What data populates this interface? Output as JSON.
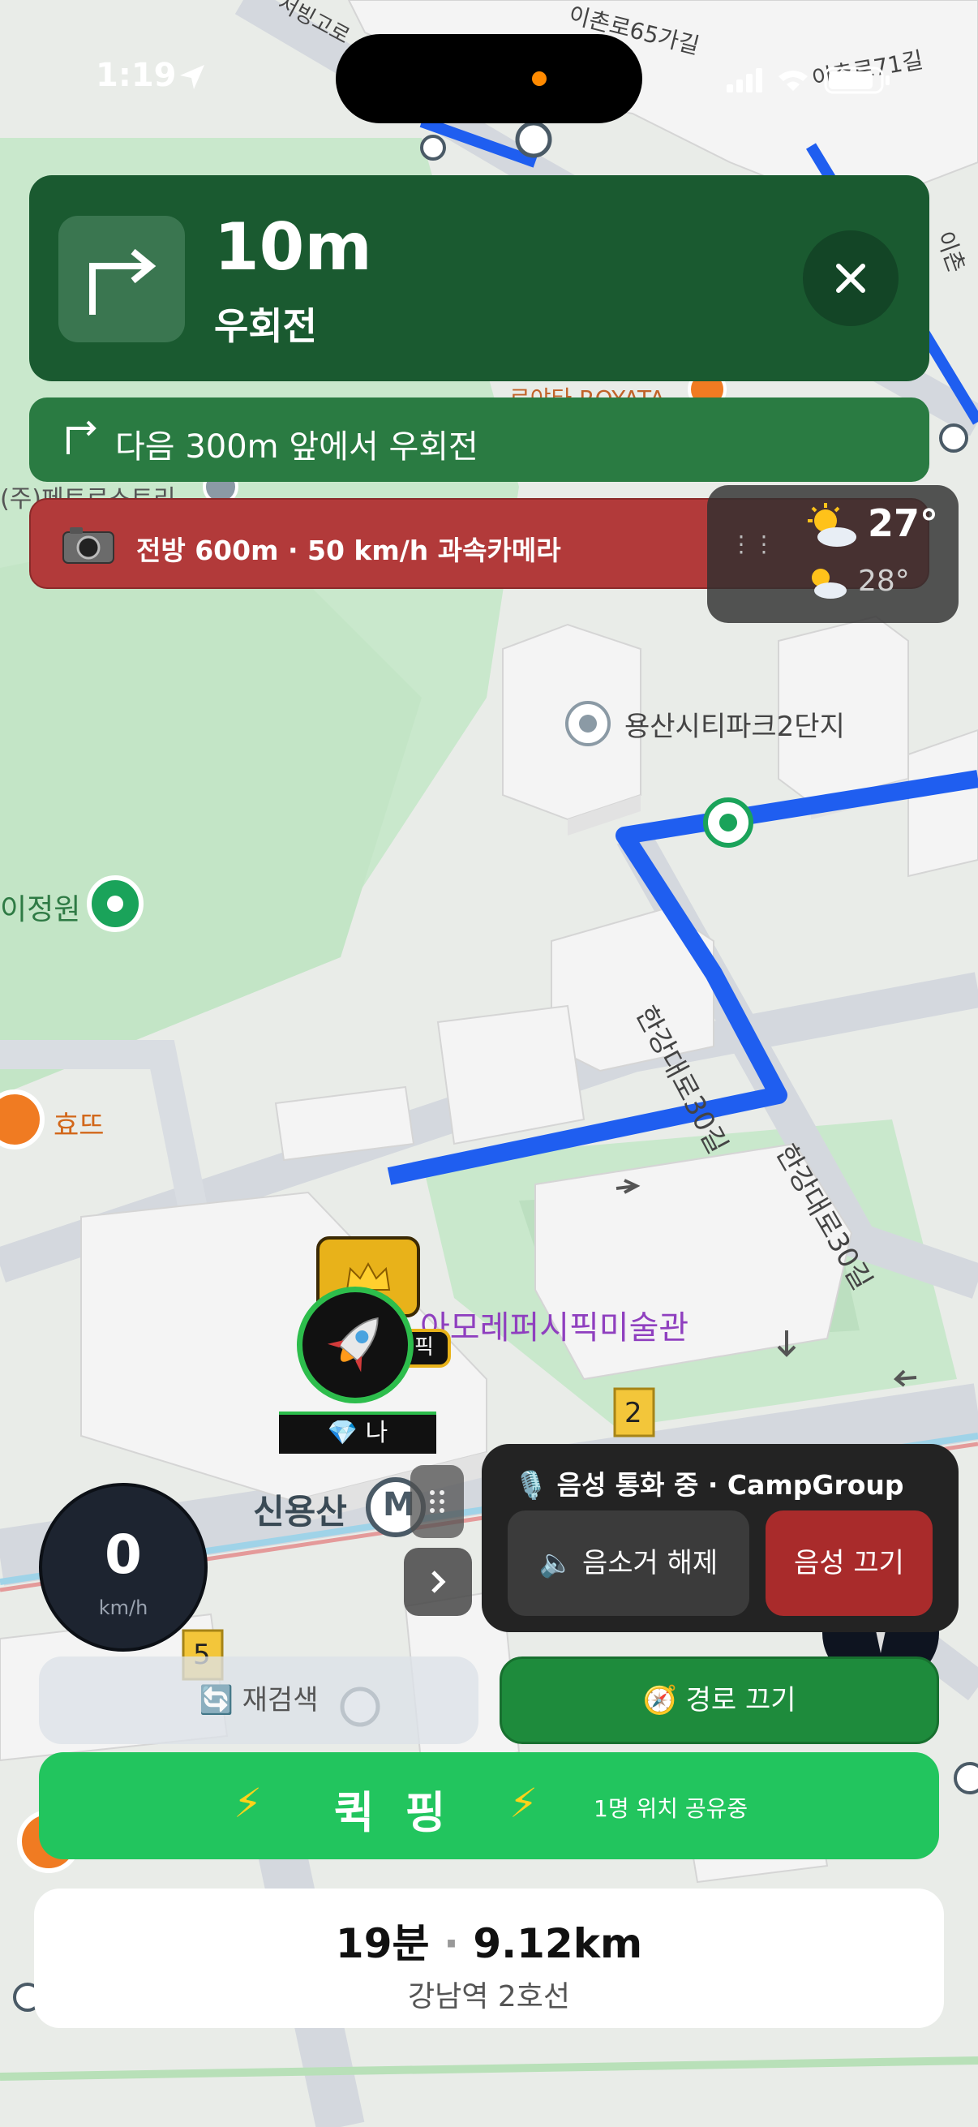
{
  "status": {
    "time": "1:19"
  },
  "turn": {
    "distance": "10m",
    "instruction": "우회전"
  },
  "next_turn": {
    "text": "다음 300m 앞에서 우회전"
  },
  "speed_camera": {
    "text": "전방 600m · 50 km/h 과속카메라"
  },
  "weather": {
    "current_temp": "27°",
    "next_temp": "28°"
  },
  "map_labels": {
    "poi_yongsan_citypark": "용산시티파크2단지",
    "poi_jeongwon": "이정원",
    "poi_hyottteu": "효뜨",
    "poi_museum": "아모레퍼시픽미술관",
    "poi_sinyongsan": "신용산",
    "poi_royata": "로야타 ROYATA",
    "poi_petrol": "(주)페트로스트리",
    "road_hangang30_a": "한강대로30길",
    "road_hangang30_b": "한강대로30길",
    "road_ichon65": "이촌로65가길",
    "road_seobinggo": "서빙고로",
    "road_ichon71": "이촌로71길",
    "road_ichon_right": "이촌",
    "shield_2": "2",
    "shield_5": "5",
    "metro_m": "M"
  },
  "marker": {
    "name": "💎 나",
    "badge": "픽"
  },
  "speed": {
    "value": "0",
    "unit": "km/h"
  },
  "voice": {
    "title": "🎙️ 음성 통화 중 · CampGroup",
    "unmute_label": "🔈 음소거 해제",
    "voice_off_label": "음성 끄기"
  },
  "route_actions": {
    "reroute_label": "🔄 재검색",
    "route_off_label": "🧭 경로 끄기"
  },
  "quick_ping": {
    "label": "퀵핑",
    "status": "1명 위치 공유중"
  },
  "eta": {
    "time": "19분",
    "distance": "9.12km",
    "destination": "강남역 2호선"
  },
  "colors": {
    "route_blue": "#1f5ef0",
    "nav_green": "#1a5a30",
    "ping_green": "#22c55e",
    "camera_red": "#b23a3a"
  }
}
